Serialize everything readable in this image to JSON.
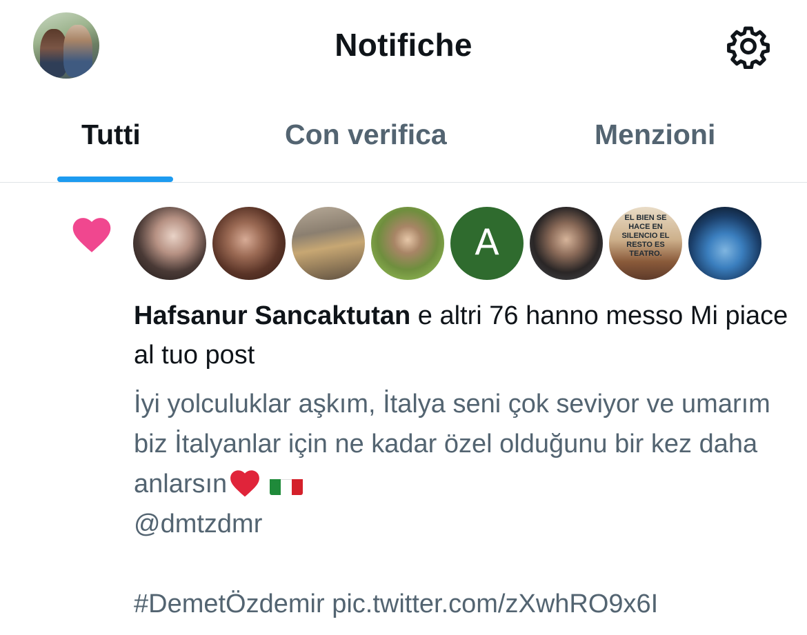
{
  "header": {
    "title": "Notifiche",
    "avatar_icon": "user-avatar",
    "settings_icon": "gear-icon"
  },
  "tabs": [
    {
      "label": "Tutti",
      "active": true
    },
    {
      "label": "Con verifica",
      "active": false
    },
    {
      "label": "Menzioni",
      "active": false
    }
  ],
  "notification": {
    "type_icon": "heart-icon",
    "icon_color": "#f0478f",
    "avatars": [
      {
        "kind": "photo"
      },
      {
        "kind": "photo"
      },
      {
        "kind": "photo"
      },
      {
        "kind": "photo"
      },
      {
        "kind": "letter",
        "letter": "A",
        "color": "#2f6b2e"
      },
      {
        "kind": "photo"
      },
      {
        "kind": "photo",
        "sign_text": "EL BIEN SE HACE EN SILENCIO EL RESTO ES TEATRO."
      },
      {
        "kind": "photo"
      }
    ],
    "actor_name": "Hafsanur Sancaktutan",
    "action_text": " e altri 76 hanno messo Mi piace al tuo post",
    "post_text_line1": "İyi yolculuklar aşkım, İtalya seni çok seviyor ve umarım biz İtalyanlar için ne kadar özel olduğunu bir kez daha anlarsın",
    "post_mention": "@dmtzdmr",
    "post_hashtag_link": "#DemetÖzdemir pic.twitter.com/zXwhRO9x6I"
  },
  "colors": {
    "accent": "#1d9bf0",
    "secondary_text": "#536471",
    "primary_text": "#0f1419"
  }
}
